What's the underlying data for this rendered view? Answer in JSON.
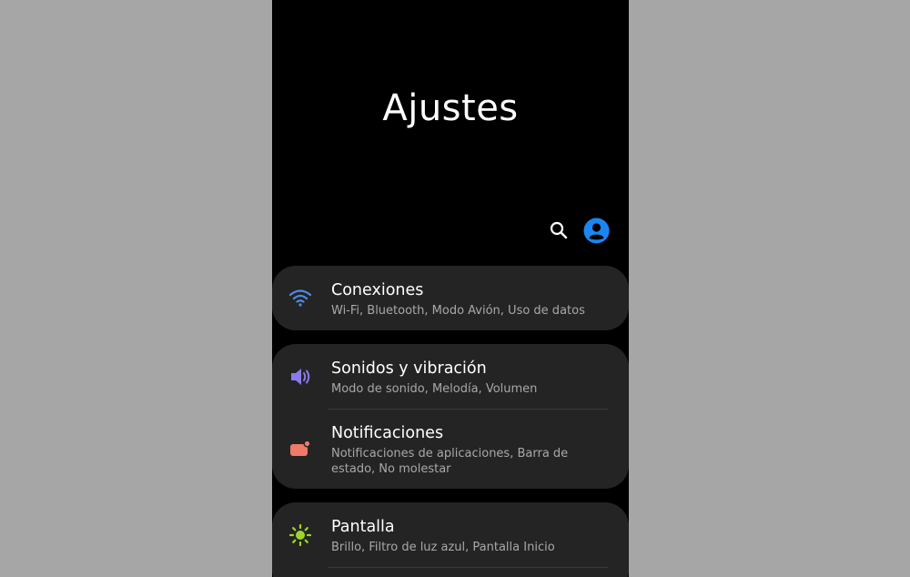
{
  "header": {
    "title": "Ajustes"
  },
  "colors": {
    "background": "#a6a6a6",
    "screen": "#000000",
    "card": "#242424",
    "account_accent": "#1b86f2",
    "conexiones_icon": "#4c8ce6",
    "sonidos_icon": "#8a7be8",
    "notificaciones_icon": "#ee7a68",
    "pantalla_icon": "#9fd42c"
  },
  "icons": {
    "search": "search-icon",
    "account": "account-icon",
    "conexiones": "wifi-icon",
    "sonidos": "volume-icon",
    "notificaciones": "notification-icon",
    "pantalla": "brightness-icon"
  },
  "settings": {
    "conexiones": {
      "title": "Conexiones",
      "subtitle": "Wi-Fi, Bluetooth, Modo Avión, Uso de datos"
    },
    "sonidos": {
      "title": "Sonidos y vibración",
      "subtitle": "Modo de sonido, Melodía, Volumen"
    },
    "notificaciones": {
      "title": "Notificaciones",
      "subtitle": "Notificaciones de aplicaciones, Barra de estado, No molestar"
    },
    "pantalla": {
      "title": "Pantalla",
      "subtitle": "Brillo, Filtro de luz azul, Pantalla Inicio"
    }
  }
}
